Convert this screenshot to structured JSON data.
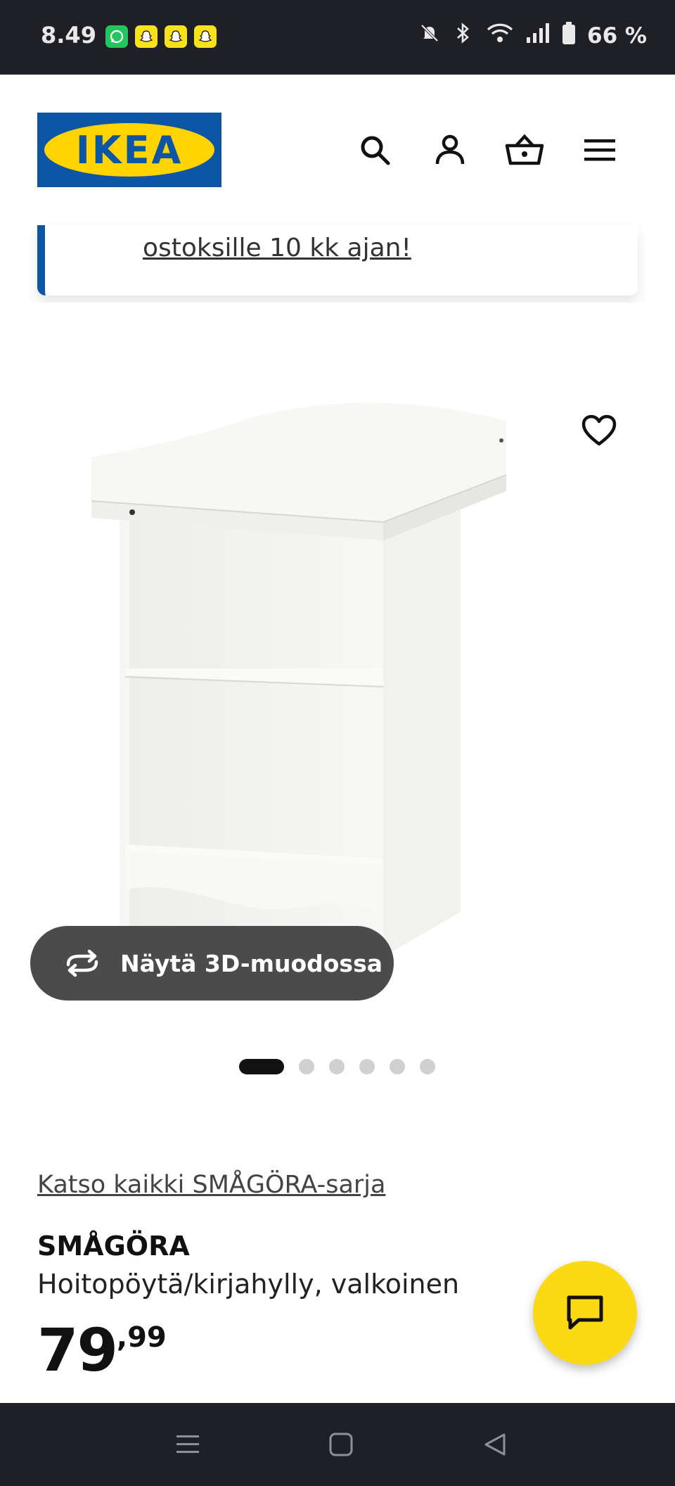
{
  "status_bar": {
    "time": "8.49",
    "battery": "66 %",
    "notification_icons": [
      "whatsapp-icon",
      "snapchat-icon",
      "snapchat-icon",
      "snapchat-icon"
    ]
  },
  "header": {
    "logo_text": "IKEA",
    "icons": [
      "search-icon",
      "account-icon",
      "basket-icon",
      "menu-icon"
    ]
  },
  "banner": {
    "link_text": "ostoksille 10 kk ajan!"
  },
  "gallery": {
    "view_3d_label": "Näytä 3D-muodossa",
    "image_count": 6,
    "active_index": 0
  },
  "product": {
    "series_link": "Katso kaikki SMÅGÖRA-sarja",
    "name": "SMÅGÖRA",
    "description": "Hoitopöytä/kirjahylly, valkoinen",
    "price_main": "79",
    "price_cents": ",99"
  },
  "colors": {
    "ikea_blue": "#0d56a5",
    "ikea_yellow": "#ffd400",
    "chat_yellow": "#fbd914",
    "system_bar": "#1f2025"
  }
}
